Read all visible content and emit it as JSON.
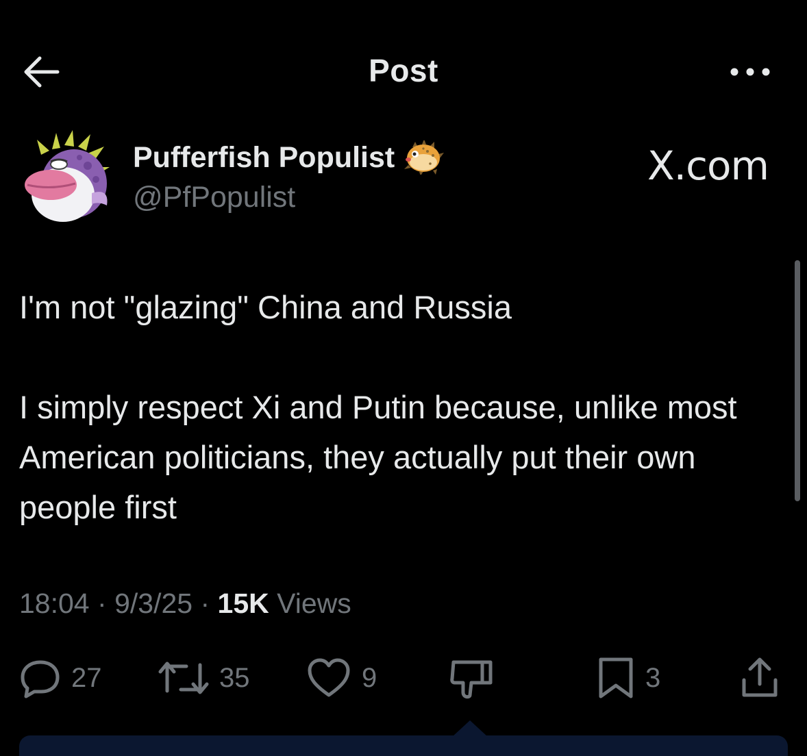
{
  "header": {
    "title": "Post"
  },
  "author": {
    "display_name": "Pufferfish Populist",
    "handle": "@PfPopulist",
    "name_emoji": "pufferfish-icon"
  },
  "watermark": "X.com",
  "post": {
    "text": "I'm not \"glazing\" China and Russia\n\nI simply respect Xi and Putin because, unlike most American politicians, they actually put their own people first"
  },
  "meta": {
    "time": "18:04",
    "date": "9/3/25",
    "views_count": "15K",
    "views_label": "Views",
    "separator": "·"
  },
  "actions": {
    "replies": "27",
    "reposts": "35",
    "likes": "9",
    "bookmarks": "3"
  },
  "colors": {
    "background": "#000000",
    "primary_text": "#e7e9ea",
    "secondary_text": "#71767b",
    "avatar_body": "#8a5fb0",
    "avatar_lips": "#e27aa0"
  }
}
